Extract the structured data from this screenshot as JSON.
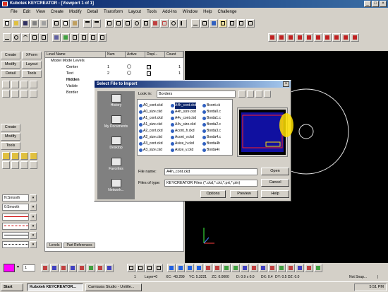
{
  "window": {
    "title": "Kubotek KEYCREATOR - [Viewport 1 of 1]",
    "min": "_",
    "max": "□",
    "close": "×"
  },
  "menu": [
    "File",
    "Edit",
    "View",
    "Create",
    "Modify",
    "Detail",
    "Transform",
    "Layout",
    "Tools",
    "Add-Ins",
    "Window",
    "Help",
    "Challenge"
  ],
  "left_tabs": {
    "create": "Create",
    "xform": "XForm",
    "modify": "Modify",
    "layout": "Layout",
    "detail": "Detail",
    "tools": "Tools"
  },
  "mid_tabs": {
    "create": "Create",
    "modify": "Modify",
    "tools": "Tools"
  },
  "line_styles": {
    "solid": "N:Smooth",
    "smooth2": "0:Smooth"
  },
  "levels": {
    "headers": [
      "Level Name",
      "Num",
      "Active",
      "Displ...",
      "Count"
    ],
    "rows": [
      {
        "name": "Model Mode Levels",
        "num": "",
        "count": ""
      },
      {
        "name": "Center",
        "num": "1",
        "count": "1"
      },
      {
        "name": "Text",
        "num": "2",
        "count": "1"
      },
      {
        "name": "Hidden",
        "num": "",
        "count": ""
      },
      {
        "name": "Visible",
        "num": "",
        "count": ""
      },
      {
        "name": "Border",
        "num": "",
        "count": ""
      }
    ],
    "bottom_tabs": [
      "Levels",
      "Part References"
    ]
  },
  "dialog": {
    "title": "Select File to Import",
    "look_in_label": "Look in:",
    "look_in_value": "Borders",
    "places": [
      "History",
      "My Documents",
      "Desktop",
      "Favorites",
      "Network..."
    ],
    "files": [
      [
        "A0_cont.ckd",
        "A0_size.ckd",
        "A1_cont.ckd",
        "A1_size.ckd",
        "A2_cont.ckd",
        "A2_size.ckd",
        "A3_cont.ckd",
        "A3_size.ckd"
      ],
      [
        "A4h_cont.ckd",
        "A4h_size.ckd",
        "A4v_cont.ckd",
        "A4v_size.ckd",
        "Acont_h.ckd",
        "Acont_v.ckd",
        "Asize_h.ckd",
        "Asize_v.ckd"
      ],
      [
        "Bcont.ck",
        "Borda0.c",
        "Borda1.c",
        "Borda2.c",
        "Borda3.c",
        "Borda4.c",
        "Borda4h",
        "Borda4v"
      ]
    ],
    "selected_file": "A4h_cont.ckd",
    "file_name_label": "File name:",
    "file_name_value": "A4h_cont.ckd",
    "file_type_label": "Files of type:",
    "file_type_value": "KEYCREATOR Files (*.ckd,*.ckt,*.prt,*.pln)",
    "buttons": {
      "open": "Open",
      "cancel": "Cancel",
      "options": "Options",
      "preview": "Preview",
      "help": "Help"
    }
  },
  "bottom": {
    "level_value": "1"
  },
  "status": [
    "1",
    "Layer=0",
    "XC: -43.299",
    "YC: 5.3221",
    "ZC: 0.0000",
    "D: 0.9 x 0.0",
    "DX: 0.4",
    "DY: 0.5",
    "DZ: 0.0",
    "Not Snap...",
    "|"
  ],
  "taskbar": {
    "start": "Start",
    "task1": "Kubotek KEYCREATOR...",
    "task2": "Camtasia Studio - Untitle...",
    "clock": "5:51 PM"
  },
  "colors": {
    "title_bar": "#0a246a",
    "viewport_bg": "#000000",
    "accent_color_box": "#ff00ff",
    "preview_border": "#ff2020",
    "highlight_yellow": "#ffe000"
  }
}
